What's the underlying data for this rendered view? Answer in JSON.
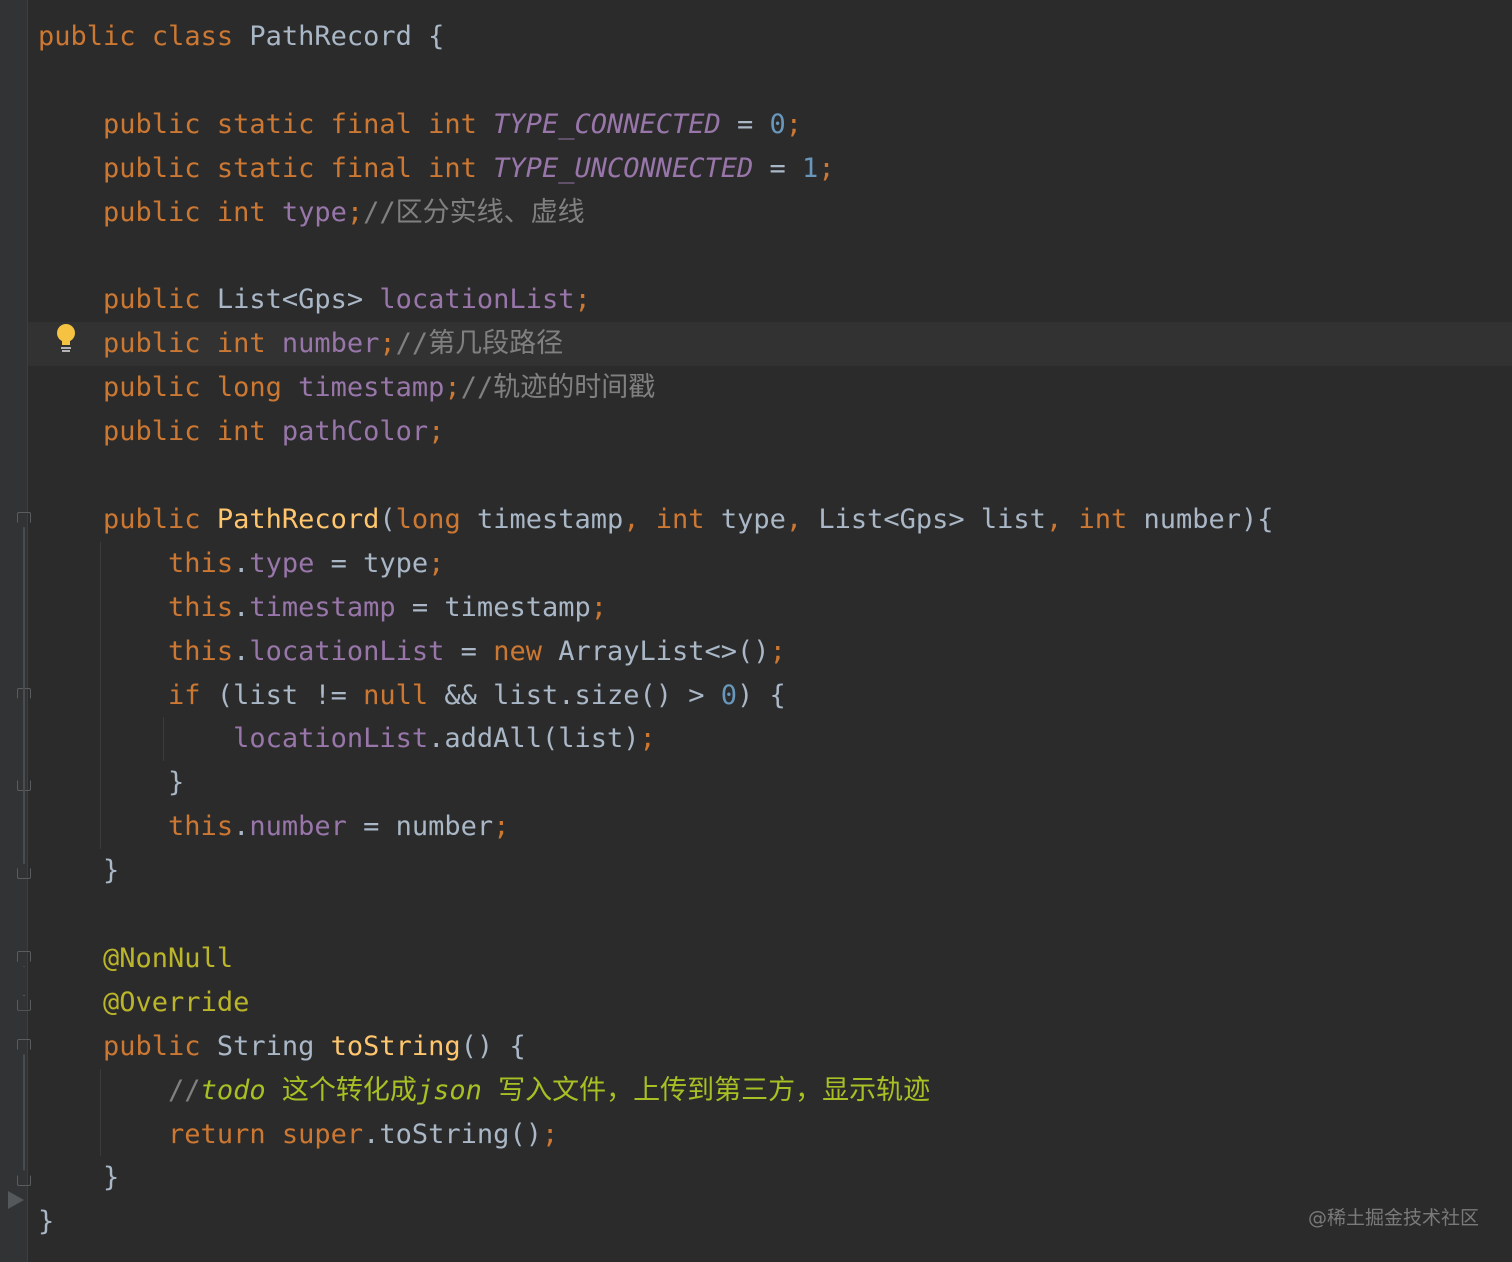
{
  "editor": {
    "language": "Java",
    "theme": "Darcula",
    "caret_line_index": 7,
    "lines": [
      [
        {
          "t": "public",
          "c": "kw"
        },
        {
          "t": " "
        },
        {
          "t": "class",
          "c": "kw"
        },
        {
          "t": " PathRecord {",
          "c": "plain"
        }
      ],
      [],
      [
        {
          "t": "    "
        },
        {
          "t": "public static final int",
          "c": "kw"
        },
        {
          "t": " "
        },
        {
          "t": "TYPE_CONNECTED",
          "c": "cfield"
        },
        {
          "t": " = ",
          "c": "plain"
        },
        {
          "t": "0",
          "c": "num"
        },
        {
          "t": ";",
          "c": "punc"
        }
      ],
      [
        {
          "t": "    "
        },
        {
          "t": "public static final int",
          "c": "kw"
        },
        {
          "t": " "
        },
        {
          "t": "TYPE_UNCONNECTED",
          "c": "cfield"
        },
        {
          "t": " = ",
          "c": "plain"
        },
        {
          "t": "1",
          "c": "num"
        },
        {
          "t": ";",
          "c": "punc"
        }
      ],
      [
        {
          "t": "    "
        },
        {
          "t": "public int",
          "c": "kw"
        },
        {
          "t": " "
        },
        {
          "t": "type",
          "c": "field"
        },
        {
          "t": ";",
          "c": "punc"
        },
        {
          "t": "//区分实线、虚线",
          "c": "cmt"
        }
      ],
      [],
      [
        {
          "t": "    "
        },
        {
          "t": "public",
          "c": "kw"
        },
        {
          "t": " List<Gps> ",
          "c": "plain"
        },
        {
          "t": "locationList",
          "c": "field"
        },
        {
          "t": ";",
          "c": "punc"
        }
      ],
      [
        {
          "t": "    "
        },
        {
          "t": "public int",
          "c": "kw"
        },
        {
          "t": " "
        },
        {
          "t": "number",
          "c": "field"
        },
        {
          "t": ";",
          "c": "punc"
        },
        {
          "t": "//第几段路径",
          "c": "cmt"
        }
      ],
      [
        {
          "t": "    "
        },
        {
          "t": "public long",
          "c": "kw"
        },
        {
          "t": " "
        },
        {
          "t": "timestamp",
          "c": "field"
        },
        {
          "t": ";",
          "c": "punc"
        },
        {
          "t": "//轨迹的时间戳",
          "c": "cmt"
        }
      ],
      [
        {
          "t": "    "
        },
        {
          "t": "public int",
          "c": "kw"
        },
        {
          "t": " "
        },
        {
          "t": "pathColor",
          "c": "field"
        },
        {
          "t": ";",
          "c": "punc"
        }
      ],
      [],
      [
        {
          "t": "    "
        },
        {
          "t": "public",
          "c": "kw"
        },
        {
          "t": " "
        },
        {
          "t": "PathRecord",
          "c": "method"
        },
        {
          "t": "(",
          "c": "plain"
        },
        {
          "t": "long",
          "c": "kw"
        },
        {
          "t": " timestamp",
          "c": "plain"
        },
        {
          "t": ", ",
          "c": "punc"
        },
        {
          "t": "int",
          "c": "kw"
        },
        {
          "t": " type",
          "c": "plain"
        },
        {
          "t": ", ",
          "c": "punc"
        },
        {
          "t": "List<Gps> list",
          "c": "plain"
        },
        {
          "t": ", ",
          "c": "punc"
        },
        {
          "t": "int",
          "c": "kw"
        },
        {
          "t": " number){",
          "c": "plain"
        }
      ],
      [
        {
          "t": "        "
        },
        {
          "t": "this",
          "c": "kw"
        },
        {
          "t": ".",
          "c": "plain"
        },
        {
          "t": "type",
          "c": "field"
        },
        {
          "t": " = type",
          "c": "plain"
        },
        {
          "t": ";",
          "c": "punc"
        }
      ],
      [
        {
          "t": "        "
        },
        {
          "t": "this",
          "c": "kw"
        },
        {
          "t": ".",
          "c": "plain"
        },
        {
          "t": "timestamp",
          "c": "field"
        },
        {
          "t": " = timestamp",
          "c": "plain"
        },
        {
          "t": ";",
          "c": "punc"
        }
      ],
      [
        {
          "t": "        "
        },
        {
          "t": "this",
          "c": "kw"
        },
        {
          "t": ".",
          "c": "plain"
        },
        {
          "t": "locationList",
          "c": "field"
        },
        {
          "t": " = ",
          "c": "plain"
        },
        {
          "t": "new",
          "c": "kw"
        },
        {
          "t": " ArrayList<>()",
          "c": "plain"
        },
        {
          "t": ";",
          "c": "punc"
        }
      ],
      [
        {
          "t": "        "
        },
        {
          "t": "if",
          "c": "kw"
        },
        {
          "t": " (list != ",
          "c": "plain"
        },
        {
          "t": "null",
          "c": "kw"
        },
        {
          "t": " && list.size() > ",
          "c": "plain"
        },
        {
          "t": "0",
          "c": "num"
        },
        {
          "t": ") {",
          "c": "plain"
        }
      ],
      [
        {
          "t": "            "
        },
        {
          "t": "locationList",
          "c": "field"
        },
        {
          "t": ".addAll(list)",
          "c": "plain"
        },
        {
          "t": ";",
          "c": "punc"
        }
      ],
      [
        {
          "t": "        }",
          "c": "plain"
        }
      ],
      [
        {
          "t": "        "
        },
        {
          "t": "this",
          "c": "kw"
        },
        {
          "t": ".",
          "c": "plain"
        },
        {
          "t": "number",
          "c": "field"
        },
        {
          "t": " = number",
          "c": "plain"
        },
        {
          "t": ";",
          "c": "punc"
        }
      ],
      [
        {
          "t": "    }",
          "c": "plain"
        }
      ],
      [],
      [
        {
          "t": "    "
        },
        {
          "t": "@NonNull",
          "c": "ann"
        }
      ],
      [
        {
          "t": "    "
        },
        {
          "t": "@Override",
          "c": "ann"
        }
      ],
      [
        {
          "t": "    "
        },
        {
          "t": "public",
          "c": "kw"
        },
        {
          "t": " String ",
          "c": "plain"
        },
        {
          "t": "toString",
          "c": "method"
        },
        {
          "t": "() {",
          "c": "plain"
        }
      ],
      [
        {
          "t": "        "
        },
        {
          "t": "//",
          "c": "cmt"
        },
        {
          "t": "todo",
          "c": "todo-i"
        },
        {
          "t": " 这个转化成",
          "c": "todo"
        },
        {
          "t": "json",
          "c": "todo-i"
        },
        {
          "t": " 写入文件，上传到第三方，显示轨迹",
          "c": "todo"
        }
      ],
      [
        {
          "t": "        "
        },
        {
          "t": "return",
          "c": "kw"
        },
        {
          "t": " "
        },
        {
          "t": "super",
          "c": "kw"
        },
        {
          "t": ".toString()",
          "c": "plain"
        },
        {
          "t": ";",
          "c": "punc"
        }
      ],
      [
        {
          "t": "    }",
          "c": "plain"
        }
      ],
      [
        {
          "t": "}",
          "c": "plain"
        }
      ]
    ]
  },
  "gutter": {
    "intention_icon": "lightbulb-icon",
    "run_icon": "run-arrow-icon",
    "fold_markers": [
      {
        "line": 11,
        "kind": "start"
      },
      {
        "line": 15,
        "kind": "start"
      },
      {
        "line": 17,
        "kind": "end"
      },
      {
        "line": 19,
        "kind": "end"
      },
      {
        "line": 21,
        "kind": "start"
      },
      {
        "line": 22,
        "kind": "end"
      },
      {
        "line": 23,
        "kind": "start"
      },
      {
        "line": 26,
        "kind": "end"
      }
    ]
  },
  "watermark": "@稀土掘金技术社区",
  "colors": {
    "background": "#2b2b2b",
    "keyword": "#cc7832",
    "field": "#9876aa",
    "number": "#6897bb",
    "comment": "#808080",
    "todo": "#a8c023",
    "method": "#ffc66d",
    "annotation": "#bbb529",
    "text": "#a9b7c6"
  }
}
